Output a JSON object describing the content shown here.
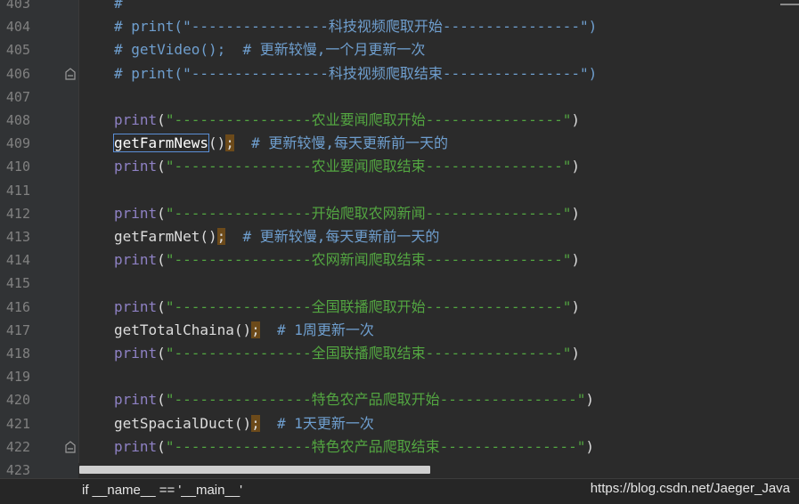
{
  "lines": [
    {
      "no": "403",
      "parts": [
        {
          "t": "#",
          "c": "comment"
        }
      ]
    },
    {
      "no": "404",
      "parts": [
        {
          "t": "# print(\"----------------科技视频爬取开始----------------\")",
          "c": "comment"
        }
      ]
    },
    {
      "no": "405",
      "parts": [
        {
          "t": "# getVideo();  # 更新较慢,一个月更新一次",
          "c": "comment"
        }
      ]
    },
    {
      "no": "406",
      "fold": true,
      "parts": [
        {
          "t": "# print(\"----------------科技视频爬取结束----------------\")",
          "c": "comment"
        }
      ]
    },
    {
      "no": "407",
      "parts": []
    },
    {
      "no": "408",
      "parts": [
        {
          "t": "print",
          "c": "fn-print"
        },
        {
          "t": "(",
          "c": "punct"
        },
        {
          "t": "\"----------------农业要闻爬取开始----------------\"",
          "c": "str"
        },
        {
          "t": ")",
          "c": "punct"
        }
      ]
    },
    {
      "no": "409",
      "parts": [
        {
          "t": "getFarmNews",
          "c": "caret-box"
        },
        {
          "t": "()",
          "c": "punct"
        },
        {
          "t": ";",
          "c": "semi"
        },
        {
          "t": "  # 更新较慢,每天更新前一天的",
          "c": "comment"
        }
      ]
    },
    {
      "no": "410",
      "parts": [
        {
          "t": "print",
          "c": "fn-print"
        },
        {
          "t": "(",
          "c": "punct"
        },
        {
          "t": "\"----------------农业要闻爬取结束----------------\"",
          "c": "str"
        },
        {
          "t": ")",
          "c": "punct"
        }
      ]
    },
    {
      "no": "411",
      "parts": []
    },
    {
      "no": "412",
      "parts": [
        {
          "t": "print",
          "c": "fn-print"
        },
        {
          "t": "(",
          "c": "punct"
        },
        {
          "t": "\"----------------开始爬取农网新闻----------------\"",
          "c": "str"
        },
        {
          "t": ")",
          "c": "punct"
        }
      ]
    },
    {
      "no": "413",
      "parts": [
        {
          "t": "getFarmNet()",
          "c": "punct"
        },
        {
          "t": ";",
          "c": "semi"
        },
        {
          "t": "  # 更新较慢,每天更新前一天的",
          "c": "comment"
        }
      ]
    },
    {
      "no": "414",
      "parts": [
        {
          "t": "print",
          "c": "fn-print"
        },
        {
          "t": "(",
          "c": "punct"
        },
        {
          "t": "\"----------------农网新闻爬取结束----------------\"",
          "c": "str"
        },
        {
          "t": ")",
          "c": "punct"
        }
      ]
    },
    {
      "no": "415",
      "parts": []
    },
    {
      "no": "416",
      "parts": [
        {
          "t": "print",
          "c": "fn-print"
        },
        {
          "t": "(",
          "c": "punct"
        },
        {
          "t": "\"----------------全国联播爬取开始----------------\"",
          "c": "str"
        },
        {
          "t": ")",
          "c": "punct"
        }
      ]
    },
    {
      "no": "417",
      "parts": [
        {
          "t": "getTotalChaina()",
          "c": "punct"
        },
        {
          "t": ";",
          "c": "semi"
        },
        {
          "t": "  # 1周更新一次",
          "c": "comment"
        }
      ]
    },
    {
      "no": "418",
      "parts": [
        {
          "t": "print",
          "c": "fn-print"
        },
        {
          "t": "(",
          "c": "punct"
        },
        {
          "t": "\"----------------全国联播爬取结束----------------\"",
          "c": "str"
        },
        {
          "t": ")",
          "c": "punct"
        }
      ]
    },
    {
      "no": "419",
      "parts": []
    },
    {
      "no": "420",
      "parts": [
        {
          "t": "print",
          "c": "fn-print"
        },
        {
          "t": "(",
          "c": "punct"
        },
        {
          "t": "\"----------------特色农产品爬取开始----------------\"",
          "c": "str"
        },
        {
          "t": ")",
          "c": "punct"
        }
      ]
    },
    {
      "no": "421",
      "parts": [
        {
          "t": "getSpacialDuct()",
          "c": "punct"
        },
        {
          "t": ";",
          "c": "semi"
        },
        {
          "t": "  # 1天更新一次",
          "c": "comment"
        }
      ]
    },
    {
      "no": "422",
      "fold": true,
      "parts": [
        {
          "t": "print",
          "c": "fn-print"
        },
        {
          "t": "(",
          "c": "punct"
        },
        {
          "t": "\"----------------特色农产品爬取结束----------------\"",
          "c": "str"
        },
        {
          "t": ")",
          "c": "punct"
        }
      ]
    },
    {
      "no": "423",
      "parts": []
    }
  ],
  "breadcrumb": "if __name__ == '__main__'",
  "watermark": "https://blog.csdn.net/Jaeger_Java",
  "colors": {
    "background": "#2b2b2b",
    "comment": "#6f9fcf",
    "string": "#53a641",
    "builtin": "#8e81c4",
    "semicolon_highlight": "#6c4a1a"
  }
}
